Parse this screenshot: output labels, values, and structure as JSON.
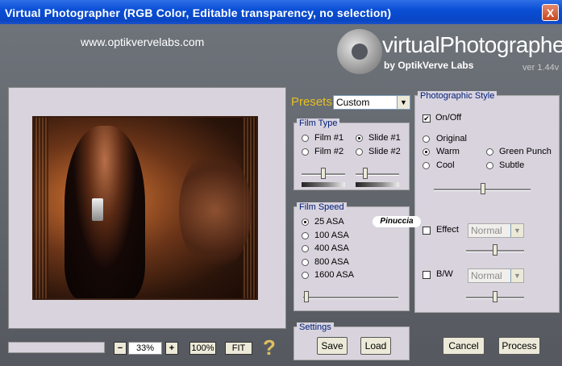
{
  "window": {
    "title": "Virtual Photographer (RGB Color, Editable transparency, no selection)",
    "close_label": "X"
  },
  "header": {
    "url": "www.optikvervelabs.com",
    "brand": "virtualPhotographer",
    "brand_sub": "by OptikVerve Labs",
    "version": "ver 1.44v"
  },
  "zoom": {
    "minus_label": "−",
    "value": "33%",
    "plus_label": "+",
    "hundred_label": "100%",
    "fit_label": "FIT",
    "help_label": "?"
  },
  "presets": {
    "label": "Presets",
    "value": "Custom"
  },
  "film_type": {
    "title": "Film Type",
    "options": [
      "Film #1",
      "Film #2",
      "Slide #1",
      "Slide #2"
    ],
    "selected": "Slide #1"
  },
  "film_speed": {
    "title": "Film Speed",
    "options": [
      "25 ASA",
      "100 ASA",
      "400 ASA",
      "800 ASA",
      "1600 ASA"
    ],
    "selected": "25 ASA"
  },
  "settings": {
    "title": "Settings",
    "save_label": "Save",
    "load_label": "Load"
  },
  "photographic_style": {
    "title": "Photographic Style",
    "onoff_label": "On/Off",
    "onoff_checked": true,
    "styles": [
      "Original",
      "Warm",
      "Cool",
      "Green Punch",
      "Subtle"
    ],
    "selected": "Warm",
    "effect_label": "Effect",
    "effect_value": "Normal",
    "bw_label": "B/W",
    "bw_value": "Normal"
  },
  "actions": {
    "cancel_label": "Cancel",
    "process_label": "Process"
  },
  "watermark": "Pinuccia",
  "icons": {
    "check": "✔",
    "dropdown": "▼"
  }
}
